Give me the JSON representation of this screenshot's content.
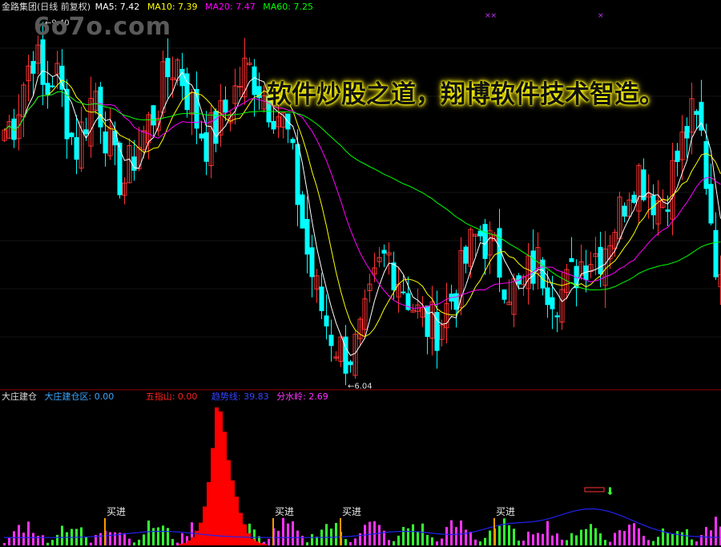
{
  "header": {
    "stock": "金路集团(日线 前复权)",
    "ma5": "MA5: 7.42",
    "ma10": "MA10: 7.39",
    "ma20": "MA20: 7.47",
    "ma60": "MA60: 7.25"
  },
  "watermark": "6o7o.com",
  "slogan": "软件炒股之道，翔博软件技术智造。",
  "indicator_header": {
    "name": "大庄建仓",
    "zone": "大庄建仓区: 0.00",
    "wuzhishan": "五指山: 0.00",
    "trend": "趋势线: 39.83",
    "watershed": "分水岭: 2.69"
  },
  "colors": {
    "up": "#ff3232",
    "down": "#00ffff",
    "ma5": "#ffffff",
    "ma10": "#ffff00",
    "ma20": "#ff00ff",
    "ma60": "#00ff00",
    "zone": "#ff0000",
    "trend": "#2222ee",
    "buy": "#ff9900",
    "vol_g": "#33ff33",
    "vol_m": "#ff33ff"
  },
  "chart_data": [
    {
      "type": "candlestick",
      "title": "金路集团(日线 前复权)",
      "annotations": [
        {
          "text": "9.40",
          "label": "high"
        },
        {
          "text": "6.04",
          "label": "low"
        }
      ],
      "series": [
        {
          "name": "MA5",
          "value": 7.42
        },
        {
          "name": "MA10",
          "value": 7.39
        },
        {
          "name": "MA20",
          "value": 7.47
        },
        {
          "name": "MA60",
          "value": 7.25
        }
      ],
      "ylim": [
        5.95,
        9.55
      ],
      "trend_close": [
        8.4,
        8.5,
        8.9,
        9.2,
        8.7,
        9.0,
        8.6,
        8.2,
        8.5,
        8.8,
        8.4,
        8.0,
        7.9,
        8.2,
        8.4,
        8.6,
        8.9,
        9.1,
        8.8,
        8.5,
        8.3,
        8.4,
        8.6,
        8.8,
        9.0,
        8.9,
        8.7,
        8.6,
        8.4,
        7.8,
        7.2,
        6.8,
        6.5,
        6.3,
        6.2,
        6.3,
        6.6,
        7.0,
        7.2,
        7.0,
        6.8,
        6.6,
        6.5,
        6.5,
        6.7,
        6.9,
        7.2,
        7.4,
        7.3,
        7.1,
        6.9,
        6.8,
        7.0,
        7.1,
        6.9,
        6.8,
        6.9,
        7.1,
        7.2,
        7.2,
        7.4,
        7.6,
        7.9,
        8.0,
        7.8,
        7.7,
        7.9,
        8.2,
        8.5,
        8.4,
        7.6,
        6.8
      ]
    },
    {
      "type": "bar",
      "title": "大庄建仓",
      "series": [
        {
          "name": "大庄建仓区",
          "value": 0.0
        },
        {
          "name": "五指山",
          "value": 0.0
        },
        {
          "name": "趋势线",
          "value": 39.83
        },
        {
          "name": "分水岭",
          "value": 2.69
        }
      ],
      "buy_label": "买进",
      "buy_count": 4,
      "zone_profile": [
        0,
        0,
        0,
        0,
        0,
        0,
        0,
        0,
        0,
        0,
        0,
        0,
        0,
        0,
        0,
        0,
        0,
        0,
        0,
        0,
        0,
        0,
        0,
        0,
        0,
        0,
        0,
        0,
        0,
        0,
        0,
        0,
        0,
        0,
        0,
        0,
        0,
        0,
        0,
        0,
        0,
        0,
        0,
        0,
        2,
        3,
        6,
        10,
        18,
        28,
        48,
        78,
        120,
        170,
        165,
        140,
        105,
        80,
        60,
        40,
        26,
        15,
        8,
        5,
        3,
        2
      ]
    }
  ]
}
